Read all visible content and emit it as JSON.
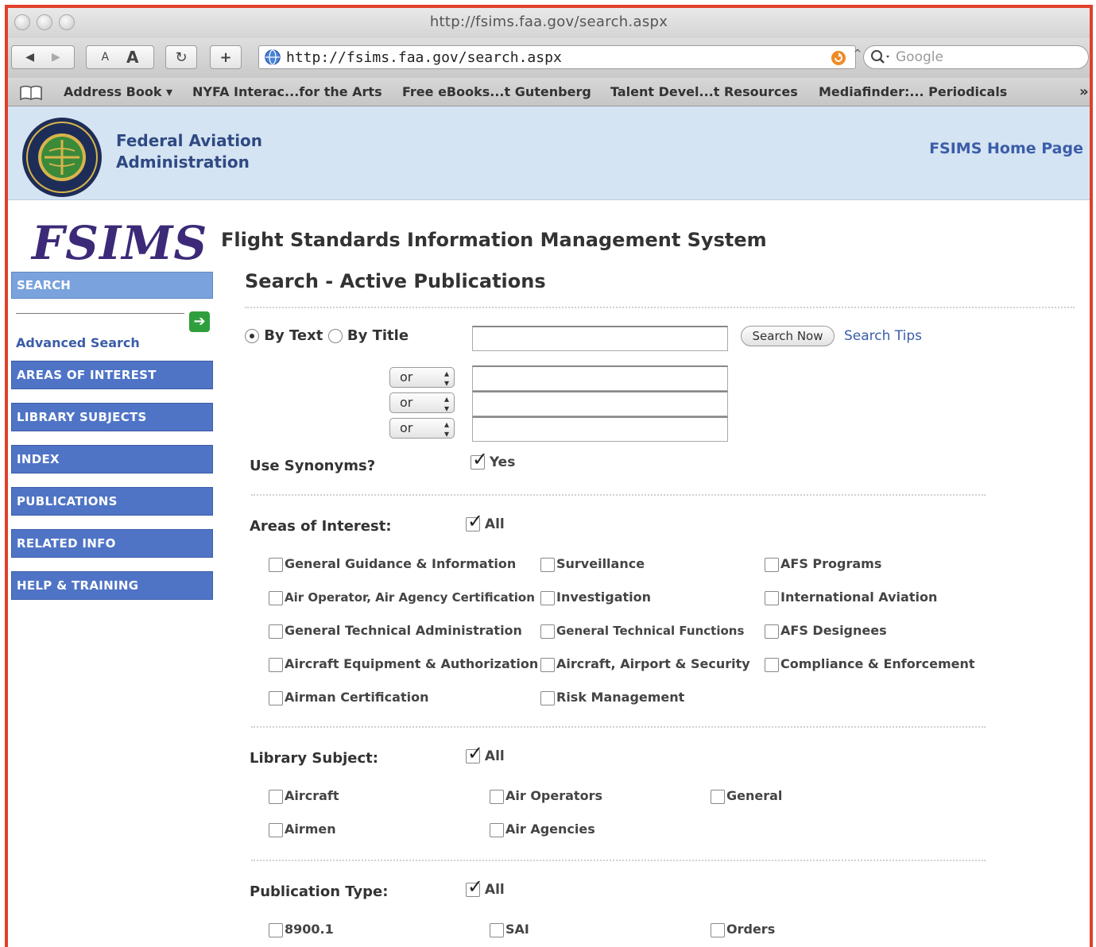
{
  "browser": {
    "window_title": "http://fsims.faa.gov/search.aspx",
    "url": "http://fsims.faa.gov/search.aspx",
    "search_placeholder": "Google",
    "text_small": "A",
    "text_large": "A",
    "bookmarks": [
      "Address Book ▾",
      "NYFA Interac...for the Arts",
      "Free eBooks...t Gutenberg",
      "Talent Devel...t Resources",
      "Mediafinder:... Periodicals"
    ],
    "bookmarks_more": "»"
  },
  "header": {
    "agency_line1": "Federal Aviation",
    "agency_line2": "Administration",
    "home_link": "FSIMS Home Page"
  },
  "logo": "FSIMS",
  "system_title": "Flight Standards Information Management System",
  "nav": {
    "search_heading": "SEARCH",
    "advanced_search": "Advanced Search",
    "items": [
      "AREAS OF INTEREST",
      "LIBRARY SUBJECTS",
      "INDEX",
      "PUBLICATIONS",
      "RELATED INFO",
      "HELP & TRAINING"
    ]
  },
  "main": {
    "heading": "Search - Active Publications",
    "by_text": "By Text",
    "by_title": "By Title",
    "search_now": "Search Now",
    "search_tips": "Search Tips",
    "operators": [
      "or",
      "or",
      "or"
    ],
    "use_synonyms_label": "Use Synonyms?",
    "yes": "Yes",
    "all": "All",
    "areas_label": "Areas of Interest:",
    "areas": [
      "General Guidance & Information",
      "Surveillance",
      "AFS Programs",
      "Air Operator, Air Agency Certification",
      "Investigation",
      "International Aviation",
      "General Technical Administration",
      "General Technical Functions",
      "AFS Designees",
      "Aircraft Equipment & Authorization",
      "Aircraft, Airport & Security",
      "Compliance & Enforcement",
      "Airman Certification",
      "Risk Management"
    ],
    "library_label": "Library Subject:",
    "library": [
      "Aircraft",
      "Air Operators",
      "General",
      "Airmen",
      "Air Agencies"
    ],
    "pubtype_label": "Publication Type:",
    "pubtypes": [
      "8900.1",
      "SAI",
      "Orders"
    ]
  },
  "colors": {
    "frame_border": "#e0402a",
    "header_bg": "#d5e4f3",
    "nav_bg": "#4f74c6",
    "nav_active_bg": "#7aa3dd",
    "link": "#3b5da8",
    "logo": "#3c2a78"
  }
}
